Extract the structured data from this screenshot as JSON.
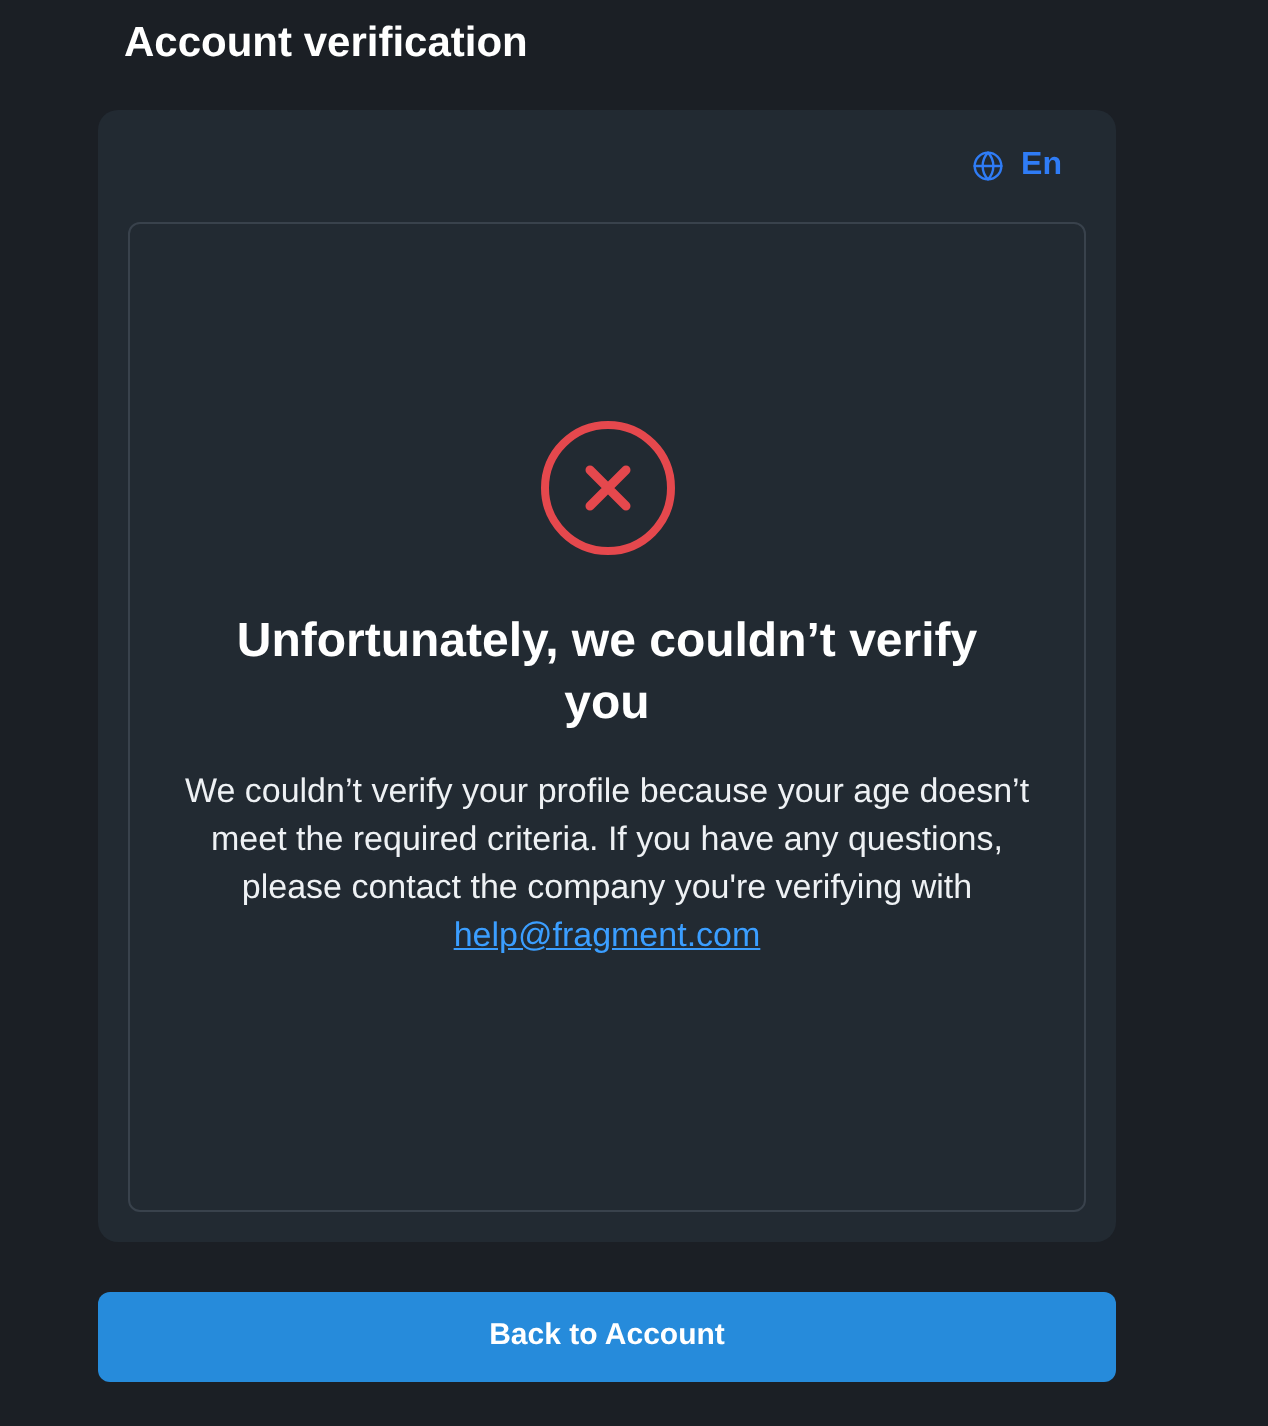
{
  "page": {
    "title": "Account verification"
  },
  "card": {
    "language": {
      "label": "En"
    },
    "result": {
      "verified": false,
      "heading": "Unfortunately, we couldn’t verify you",
      "message": "We couldn’t verify your profile because your age doesn’t meet the required criteria. If you have any questions, please contact the company you're verifying with",
      "contact_email": "help@fragment.com"
    }
  },
  "buttons": [
    {
      "label": "Back to Account"
    }
  ]
}
